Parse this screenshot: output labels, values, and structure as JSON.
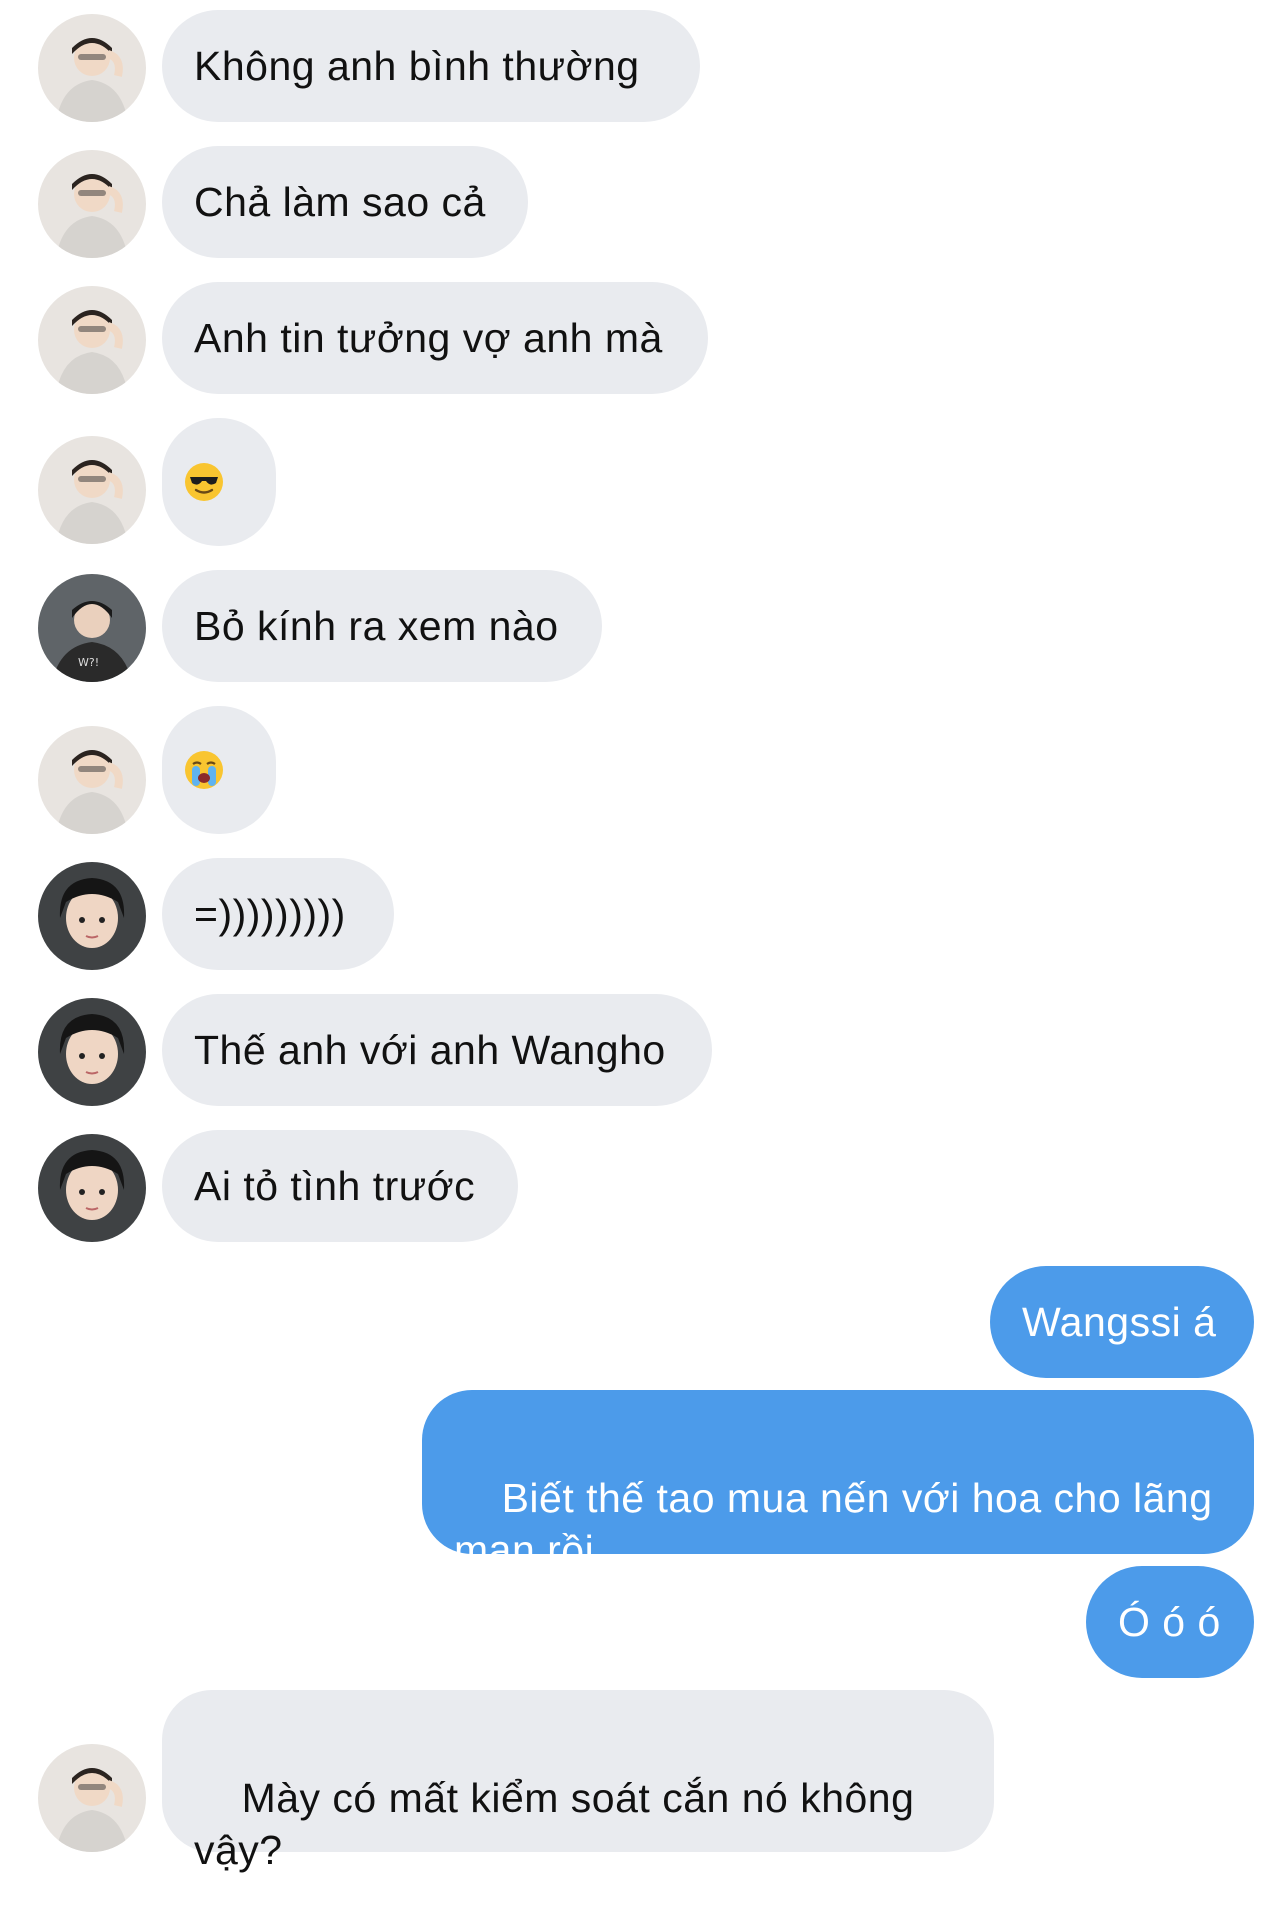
{
  "messages": [
    {
      "text": "Không anh bình thường"
    },
    {
      "text": "Chả làm sao cả"
    },
    {
      "text": "Anh tin tưởng vợ anh mà"
    },
    {
      "emoji": "sunglasses-emoji"
    },
    {
      "text": "Bỏ kính ra xem nào"
    },
    {
      "emoji": "loudly-crying-emoji"
    },
    {
      "text": "=)))))))))"
    },
    {
      "text": "Thế anh với anh Wangho"
    },
    {
      "text": "Ai tỏ tình trước"
    },
    {
      "text": "Wangssi á"
    },
    {
      "text": "Biết thế tao mua nến với hoa cho lãng mạn rồi"
    },
    {
      "text": "Ó ó ó"
    },
    {
      "text": "Mày có mất kiểm soát cắn nó không vậy?"
    }
  ],
  "colors": {
    "incoming_bubble": "#e9ebef",
    "outgoing_bubble": "#4c9bea",
    "incoming_text": "#111111",
    "outgoing_text": "#ffffff"
  }
}
